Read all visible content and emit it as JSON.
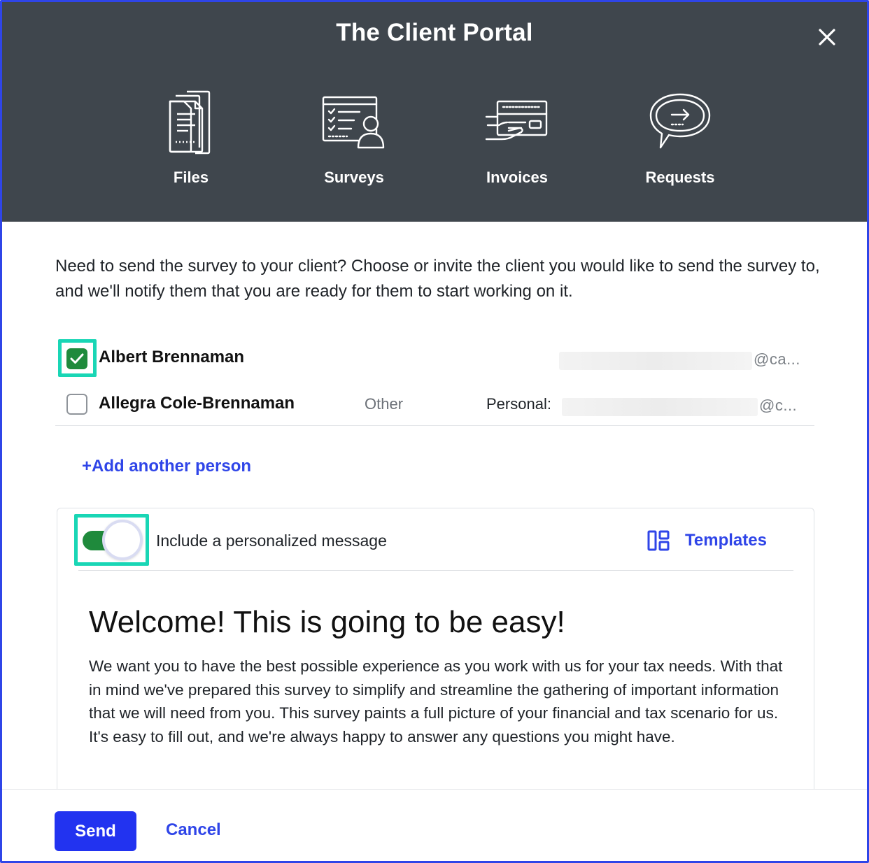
{
  "header": {
    "title": "The Client Portal",
    "features": [
      {
        "label": "Files",
        "icon": "files-icon"
      },
      {
        "label": "Surveys",
        "icon": "survey-icon"
      },
      {
        "label": "Invoices",
        "icon": "invoice-icon"
      },
      {
        "label": "Requests",
        "icon": "request-icon"
      }
    ]
  },
  "intro": "Need to send the survey to your client? Choose or invite the client you would like to send the survey to, and we'll notify them that you are ready for them to start working on it.",
  "recipients": [
    {
      "name": "Albert Brennaman",
      "relation": "",
      "email_label": "",
      "email_suffix": "@ca...",
      "checked": true
    },
    {
      "name": "Allegra Cole-Brennaman",
      "relation": "Other",
      "email_label": "Personal:",
      "email_suffix": "@c...",
      "checked": false
    }
  ],
  "add_person": "+Add another person",
  "message": {
    "toggle_label": "Include a personalized message",
    "toggle_on": true,
    "templates_label": "Templates",
    "heading": "Welcome! This is going to be easy!",
    "body": "We want you to have the best possible experience as you work with us for your tax needs. With that in mind we've prepared this survey to simplify and streamline the gathering of important information that we will need from you. This survey paints a full picture of your financial and tax scenario for us. It's easy to fill out, and we're always happy to answer any questions you might have."
  },
  "footer": {
    "send_label": "Send",
    "cancel_label": "Cancel"
  },
  "colors": {
    "header_bg": "#3f464d",
    "accent": "#2f45e8",
    "highlight": "#19d6b5",
    "check_green": "#1f8a3c"
  }
}
